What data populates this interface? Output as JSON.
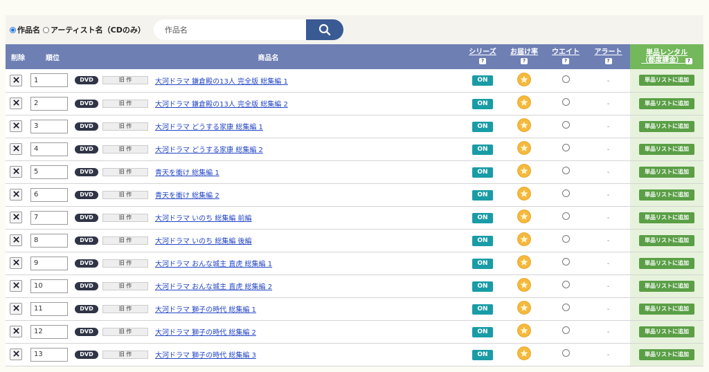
{
  "search": {
    "options": [
      "作品名",
      "アーティスト名（CDのみ）"
    ],
    "selected_index": 0,
    "placeholder": "作品名"
  },
  "table": {
    "headers": {
      "delete": "削除",
      "rank": "順位",
      "product": "商品名",
      "series": "シリーズ",
      "delivery": "お届け率",
      "weight": "ウエイト",
      "alert": "アラート",
      "rental_line1": "単品レンタル",
      "rental_line2": "（都度課金）",
      "help": "?"
    },
    "rows": [
      {
        "rank": "1",
        "media": "DVD",
        "status": "旧 作",
        "title": "大河ドラマ 鎌倉殿の13人 完全版 総集編 1",
        "series": "ON",
        "alert": "-",
        "action": "単品リストに追加"
      },
      {
        "rank": "2",
        "media": "DVD",
        "status": "旧 作",
        "title": "大河ドラマ 鎌倉殿の13人 完全版 総集編 2",
        "series": "ON",
        "alert": "-",
        "action": "単品リストに追加"
      },
      {
        "rank": "3",
        "media": "DVD",
        "status": "旧 作",
        "title": "大河ドラマ どうする家康 総集編 1",
        "series": "ON",
        "alert": "-",
        "action": "単品リストに追加"
      },
      {
        "rank": "4",
        "media": "DVD",
        "status": "旧 作",
        "title": "大河ドラマ どうする家康 総集編 2",
        "series": "ON",
        "alert": "-",
        "action": "単品リストに追加"
      },
      {
        "rank": "5",
        "media": "DVD",
        "status": "旧 作",
        "title": "青天を衝け 総集編 1",
        "series": "ON",
        "alert": "-",
        "action": "単品リストに追加"
      },
      {
        "rank": "6",
        "media": "DVD",
        "status": "旧 作",
        "title": "青天を衝け 総集編 2",
        "series": "ON",
        "alert": "-",
        "action": "単品リストに追加"
      },
      {
        "rank": "7",
        "media": "DVD",
        "status": "旧 作",
        "title": "大河ドラマ いのち 総集編 前編",
        "series": "ON",
        "alert": "-",
        "action": "単品リストに追加"
      },
      {
        "rank": "8",
        "media": "DVD",
        "status": "旧 作",
        "title": "大河ドラマ いのち 総集編 後編",
        "series": "ON",
        "alert": "-",
        "action": "単品リストに追加"
      },
      {
        "rank": "9",
        "media": "DVD",
        "status": "旧 作",
        "title": "大河ドラマ おんな城主 直虎 総集編 1",
        "series": "ON",
        "alert": "-",
        "action": "単品リストに追加"
      },
      {
        "rank": "10",
        "media": "DVD",
        "status": "旧 作",
        "title": "大河ドラマ おんな城主 直虎 総集編 2",
        "series": "ON",
        "alert": "-",
        "action": "単品リストに追加"
      },
      {
        "rank": "11",
        "media": "DVD",
        "status": "旧 作",
        "title": "大河ドラマ 獅子の時代 総集編 1",
        "series": "ON",
        "alert": "-",
        "action": "単品リストに追加"
      },
      {
        "rank": "12",
        "media": "DVD",
        "status": "旧 作",
        "title": "大河ドラマ 獅子の時代 総集編 2",
        "series": "ON",
        "alert": "-",
        "action": "単品リストに追加"
      },
      {
        "rank": "13",
        "media": "DVD",
        "status": "旧 作",
        "title": "大河ドラマ 獅子の時代 総集編 3",
        "series": "ON",
        "alert": "-",
        "action": "単品リストに追加"
      }
    ]
  },
  "icons": {
    "delete": "close-icon",
    "search": "search-icon",
    "delivery": "star-icon",
    "weight": "radio-circle-icon"
  },
  "colors": {
    "header_bg": "#6e7fb4",
    "rental_header_bg": "#73b85b",
    "on_badge": "#199ca6",
    "add_button": "#5a9f46",
    "link": "#2345c4",
    "search_button": "#3a5a94",
    "star_fill": "#f6b93b"
  }
}
